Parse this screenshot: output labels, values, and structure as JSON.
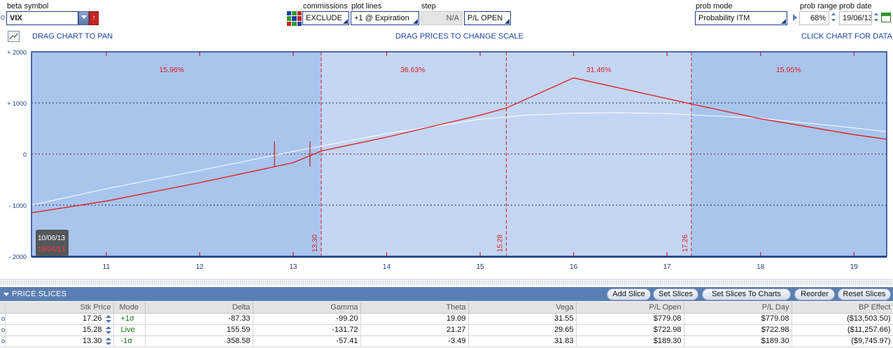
{
  "controls": {
    "beta_symbol_label": "beta symbol",
    "beta_symbol_value": "VIX",
    "commissions_label": "commissions",
    "commissions_value": "EXCLUDE",
    "plot_lines_label": "plot lines",
    "plot_lines_value": "+1 @ Expiration",
    "step_label": "step",
    "step_value": "N/A",
    "pl_mode_value": "P/L OPEN",
    "prob_mode_label": "prob mode",
    "prob_mode_value": "Probability ITM",
    "prob_range_label": "prob range",
    "prob_range_value": "68%",
    "prob_date_label": "prob date",
    "prob_date_value": "19/06/13"
  },
  "hints": {
    "pan": "DRAG CHART TO PAN",
    "scale": "DRAG PRICES TO CHANGE SCALE",
    "data": "CLICK CHART FOR DATA"
  },
  "chart_data": {
    "type": "line",
    "x_ticks": [
      "11",
      "12",
      "13",
      "14",
      "15",
      "16",
      "17",
      "18",
      "19"
    ],
    "y_ticks": [
      "+ 2000",
      "+ 1000",
      "0",
      "- 1000",
      "- 2000"
    ],
    "xlim": [
      10.2,
      19.35
    ],
    "ylim": [
      -2000,
      2000
    ],
    "grid": true,
    "series": [
      {
        "color": "#e01b1b",
        "x": [
          10.2,
          11.0,
          12.0,
          13.0,
          13.3,
          14.0,
          15.0,
          15.28,
          16.0,
          17.26,
          18.0,
          19.0,
          19.35
        ],
        "y": [
          -1150,
          -920,
          -560,
          -170,
          60,
          330,
          760,
          900,
          1490,
          980,
          690,
          380,
          290
        ]
      },
      {
        "color": "#ffffff",
        "x": [
          10.2,
          11.0,
          12.0,
          13.0,
          14.0,
          15.0,
          15.5,
          16.0,
          16.5,
          17.0,
          18.0,
          19.0,
          19.35
        ],
        "y": [
          -1000,
          -680,
          -320,
          50,
          400,
          680,
          760,
          800,
          810,
          790,
          700,
          510,
          440
        ]
      }
    ],
    "slice_lines": [
      {
        "x": 13.3,
        "label": "13.30"
      },
      {
        "x": 15.28,
        "label": "15.28"
      },
      {
        "x": 17.26,
        "label": "17.26"
      }
    ],
    "probability_labels": [
      {
        "x": 11.7,
        "label": "15.96%"
      },
      {
        "x": 14.28,
        "label": "36.63%"
      },
      {
        "x": 16.27,
        "label": "31.46%"
      },
      {
        "x": 18.3,
        "label": "15.95%"
      }
    ],
    "current_price_markers": [
      12.8,
      13.18
    ],
    "date_badge": {
      "current": "10/06/13",
      "expiration": "19/06/13"
    },
    "colors": {
      "outer_band": "#a9c5ee",
      "inner_band": "#c3d6f3",
      "axis": "#1e3f8a",
      "line_red": "#e01b1b"
    }
  },
  "slices_panel": {
    "title": "PRICE SLICES",
    "buttons": [
      "Add Slice",
      "Set Slices",
      "Set Slices To Charts",
      "Reorder",
      "Reset Slices"
    ],
    "columns": [
      "Stk Price",
      "Mode",
      "Delta",
      "Gamma",
      "Theta",
      "Vega",
      "P/L Open",
      "P/L Day",
      "BP Effect"
    ],
    "rows": [
      [
        "17.26",
        "+1σ",
        "-87.33",
        "-99.20",
        "19.09",
        "31.55",
        "$779.08",
        "$779.08",
        "($13,503.50)"
      ],
      [
        "15.28",
        "Live",
        "155.59",
        "-131.72",
        "21.27",
        "29.65",
        "$722.98",
        "$722.98",
        "($11,257.66)"
      ],
      [
        "13.30",
        "-1σ",
        "358.58",
        "-57.41",
        "-3.49",
        "31.83",
        "$189.30",
        "$189.30",
        "($9,745.97)"
      ]
    ]
  }
}
